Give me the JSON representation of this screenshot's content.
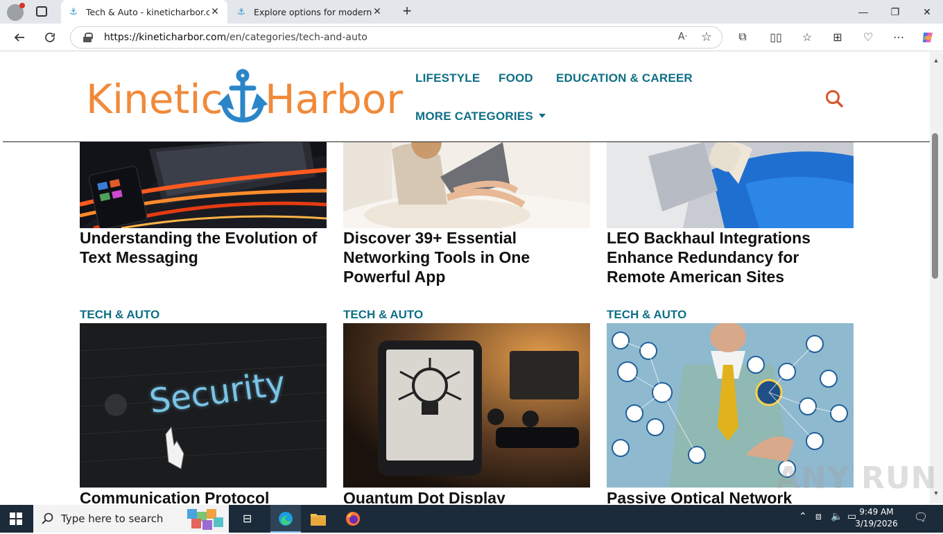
{
  "browser": {
    "tabs": [
      {
        "title": "Tech & Auto - kineticharbor.com",
        "close": "✕"
      },
      {
        "title": "Explore options for modern interi",
        "close": "✕"
      }
    ],
    "new_tab": "+",
    "url_host": "https://kineticharbor.com",
    "url_path": "/en/categories/tech-and-auto",
    "window_controls": {
      "minimize": "—",
      "restore": "❐",
      "close": "✕"
    }
  },
  "site": {
    "logo_text": "Kinetic Harbor",
    "nav": {
      "lifestyle": "LIFESTYLE",
      "food": "FOOD",
      "education": "EDUCATION & CAREER",
      "more": "MORE CATEGORIES"
    }
  },
  "articles_top": [
    {
      "title": "Understanding the Evolution of Text Messaging"
    },
    {
      "title": "Discover 39+ Essential Networking Tools in One Powerful App"
    },
    {
      "title": "LEO Backhaul Integrations Enhance Redundancy for Remote American Sites"
    }
  ],
  "articles_bottom": [
    {
      "category": "TECH & AUTO",
      "title": "Communication Protocol",
      "image_text": "Security"
    },
    {
      "category": "TECH & AUTO",
      "title": "Quantum Dot Display"
    },
    {
      "category": "TECH & AUTO",
      "title": "Passive Optical Network"
    }
  ],
  "taskbar": {
    "search_placeholder": "Type here to search",
    "time": "9:49 AM",
    "date": "3/19/2026"
  },
  "watermark": "ANY RUN",
  "colors": {
    "accent": "#0e6f86",
    "logo_orange": "#f08a3a",
    "logo_blue": "#2a86c8",
    "search_red": "#d9532b"
  }
}
